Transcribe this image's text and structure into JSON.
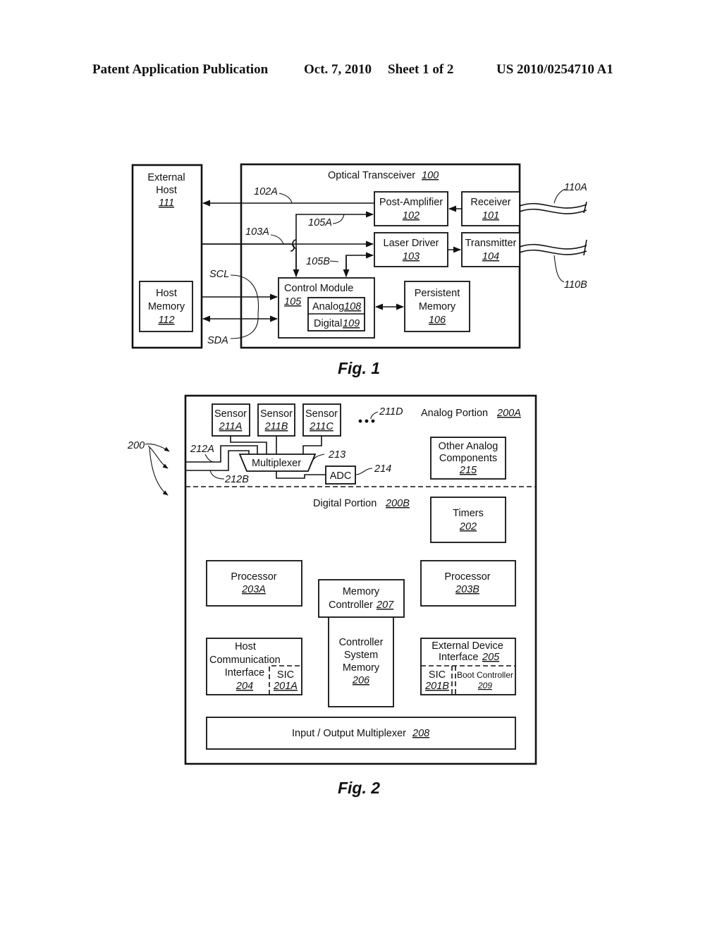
{
  "header": {
    "publication": "Patent Application Publication",
    "date": "Oct. 7, 2010",
    "sheet": "Sheet 1 of 2",
    "patent_number": "US 2010/0254710 A1"
  },
  "fig1": {
    "caption": "Fig. 1",
    "external_host": {
      "line1": "External",
      "line2": "Host",
      "ref": "111"
    },
    "host_memory": {
      "line1": "Host",
      "line2": "Memory",
      "ref": "112"
    },
    "transceiver": {
      "label": "Optical Transceiver",
      "ref": "100"
    },
    "post_amplifier": {
      "label": "Post-Amplifier",
      "ref": "102"
    },
    "receiver": {
      "label": "Receiver",
      "ref": "101"
    },
    "laser_driver": {
      "label": "Laser Driver",
      "ref": "103"
    },
    "transmitter": {
      "label": "Transmitter",
      "ref": "104"
    },
    "control_module": {
      "label": "Control Module",
      "ref": "105"
    },
    "analog": {
      "label": "Analog",
      "ref": "108"
    },
    "digital": {
      "label": "Digital",
      "ref": "109"
    },
    "persistent_memory": {
      "line1": "Persistent",
      "line2": "Memory",
      "ref": "106"
    },
    "tags": {
      "t102A": "102A",
      "t103A": "103A",
      "t105A": "105A",
      "t105B": "105B",
      "t110A": "110A",
      "t110B": "110B",
      "scl": "SCL",
      "sda": "SDA"
    }
  },
  "fig2": {
    "caption": "Fig. 2",
    "ref_200": "200",
    "analog_portion": {
      "label": "Analog Portion",
      "ref": "200A"
    },
    "digital_portion": {
      "label": "Digital Portion",
      "ref": "200B"
    },
    "sensors": [
      {
        "label": "Sensor",
        "ref": "211A"
      },
      {
        "label": "Sensor",
        "ref": "211B"
      },
      {
        "label": "Sensor",
        "ref": "211C"
      }
    ],
    "tag_211D": "211D",
    "multiplexer": {
      "label": "Multiplexer",
      "tag": "213"
    },
    "adc": {
      "label": "ADC",
      "tag": "214"
    },
    "tag_212A": "212A",
    "tag_212B": "212B",
    "other_analog": {
      "line1": "Other Analog",
      "line2": "Components",
      "ref": "215"
    },
    "timers": {
      "label": "Timers",
      "ref": "202"
    },
    "processor_a": {
      "label": "Processor",
      "ref": "203A"
    },
    "processor_b": {
      "label": "Processor",
      "ref": "203B"
    },
    "memory_controller": {
      "line1": "Memory",
      "line2": "Controller",
      "ref": "207"
    },
    "controller_system_memory": {
      "line1": "Controller",
      "line2": "System",
      "line3": "Memory",
      "ref": "206"
    },
    "host_comm_interface": {
      "line1": "Host",
      "line2": "Communication",
      "line3": "Interface",
      "ref": "204"
    },
    "sic_a": {
      "label": "SIC",
      "ref": "201A"
    },
    "external_device_interface": {
      "line1": "External Device",
      "line2": "Interface",
      "ref": "205"
    },
    "sic_b": {
      "label": "SIC",
      "ref": "201B"
    },
    "boot_controller": {
      "label": "Boot Controller",
      "ref": "209"
    },
    "io_multiplexer": {
      "label": "Input / Output Multiplexer",
      "ref": "208"
    }
  }
}
